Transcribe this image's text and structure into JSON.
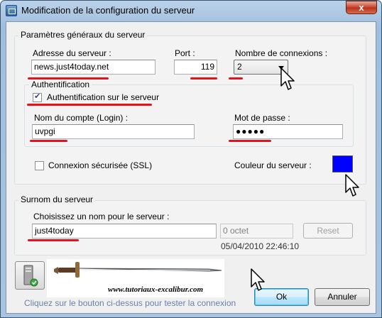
{
  "window": {
    "title": "Modification de la configuration du serveur",
    "close_glyph": "x"
  },
  "general": {
    "group_label": "Paramètres généraux du serveur",
    "address_label": "Adresse du serveur :",
    "address_value": "news.just4today.net",
    "port_label": "Port :",
    "port_value": "119",
    "connections_label": "Nombre de connexions :",
    "connections_value": "2",
    "auth_group_label": "Authentification",
    "auth_checkbox_label": "Authentification sur le serveur",
    "auth_checked": true,
    "login_label": "Nom du compte (Login) :",
    "login_value": "uvpgi",
    "password_label": "Mot de passe :",
    "password_value": "●●●●●",
    "ssl_label": "Connexion sécurisée (SSL)",
    "ssl_checked": false,
    "color_label": "Couleur du serveur :",
    "color_value": "#0000ff"
  },
  "nickname": {
    "group_label": "Surnom du serveur",
    "prompt_label": "Choisissez un nom pour le serveur :",
    "name_value": "just4today",
    "size_value": "0 octet",
    "reset_label": "Reset",
    "timestamp": "05/04/2010 22:46:10"
  },
  "footer": {
    "banner_text": "www.tutoriaux-excalibur.com",
    "hint": "Cliquez sur le bouton ci-dessus pour tester la connexion",
    "ok_label": "Ok",
    "cancel_label": "Annuler"
  },
  "icons": {
    "app": "app-window-icon",
    "tester": "server-test-icon",
    "banner": "sword-icon",
    "cursor": "mouse-pointer-icon"
  },
  "colors": {
    "annotation": "#e8101a",
    "server_color": "#0000ff",
    "hint": "#6d7fa6"
  }
}
